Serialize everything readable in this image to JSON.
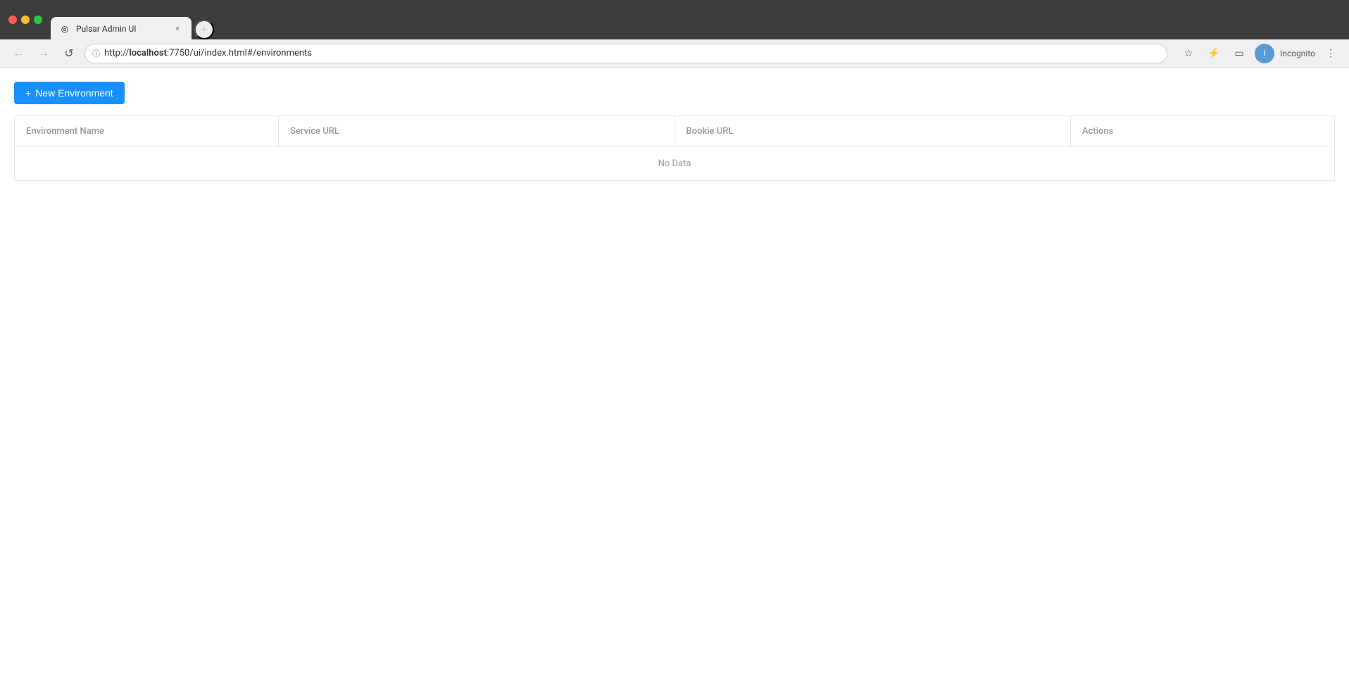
{
  "browser": {
    "tab": {
      "favicon": "◎",
      "title": "Pulsar Admin UI",
      "close_label": "×"
    },
    "new_tab_label": "+",
    "nav": {
      "back_label": "←",
      "forward_label": "→",
      "reload_label": "↺"
    },
    "address_bar": {
      "protocol": "http://",
      "domain": "localhost",
      "path": ":7750/ui/index.html#/environments"
    },
    "toolbar": {
      "bookmark_label": "☆",
      "extensions_label": "⚡",
      "window_label": "▭",
      "profile_initials": "I",
      "profile_name": "Incognito",
      "menu_label": "⋮"
    }
  },
  "page": {
    "new_env_button": {
      "icon": "+",
      "label": "New Environment"
    },
    "table": {
      "columns": [
        {
          "key": "name",
          "label": "Environment Name"
        },
        {
          "key": "service_url",
          "label": "Service URL"
        },
        {
          "key": "bookie_url",
          "label": "Bookie URL"
        },
        {
          "key": "actions",
          "label": "Actions"
        }
      ],
      "empty_message": "No Data"
    }
  }
}
